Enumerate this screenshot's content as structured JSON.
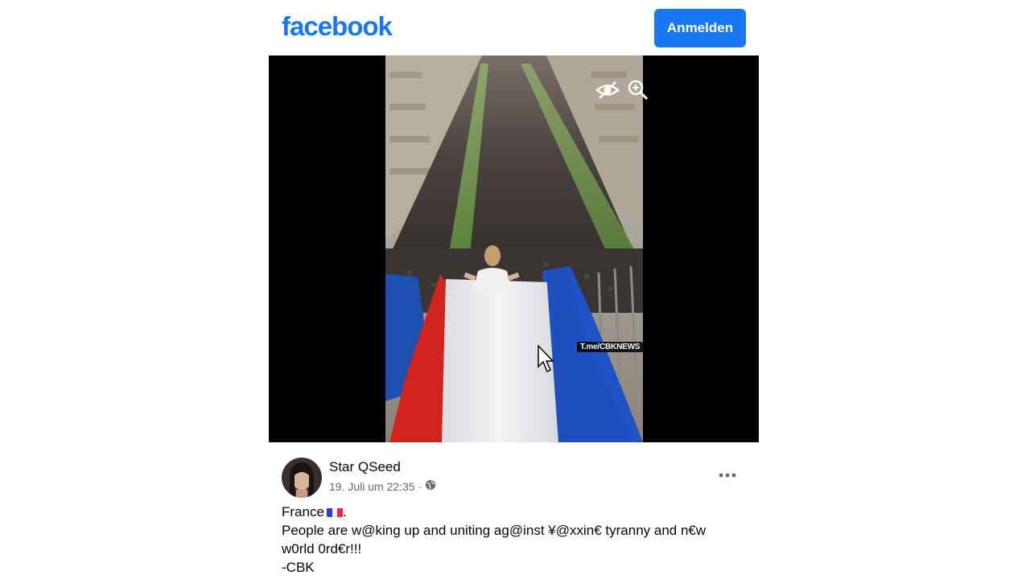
{
  "header": {
    "logo_text": "facebook",
    "login_label": "Anmelden",
    "brand_color": "#1877f2"
  },
  "media": {
    "watermark": "T.me/CBKNEWS",
    "controls": [
      {
        "name": "hide-icon"
      },
      {
        "name": "zoom-in-icon"
      }
    ]
  },
  "post": {
    "author": "Star QSeed",
    "timestamp": "19. Juli um 22:35",
    "separator": "·",
    "audience_icon": "globe-icon",
    "more_icon": "more-options-icon",
    "lines": [
      "France",
      "People are w@king up and uniting ag@inst ¥@xxin€ tyranny and n€w",
      "w0rld 0rd€r!!!",
      "-CBK"
    ],
    "suffix_after_flag": "."
  }
}
